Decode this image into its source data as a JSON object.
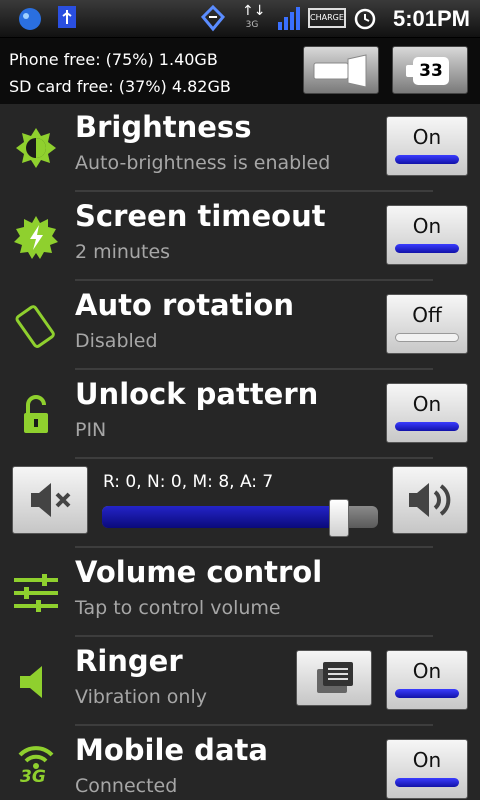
{
  "status_bar": {
    "time": "5:01PM",
    "network_type": "3G",
    "charge_label": "CHARGE",
    "icons": [
      "app-icon",
      "usb-icon",
      "sync-icon",
      "data-arrows-icon",
      "signal-icon",
      "charge-icon",
      "alarm-icon"
    ]
  },
  "storage": {
    "phone_free": "Phone free: (75%) 1.40GB",
    "sd_free": "SD card free: (37%) 4.82GB",
    "battery_level": "33"
  },
  "settings": [
    {
      "title": "Brightness",
      "subtitle": "Auto-brightness is enabled",
      "state": "On",
      "icon": "brightness-icon"
    },
    {
      "title": "Screen timeout",
      "subtitle": "2 minutes",
      "state": "On",
      "icon": "screen-timeout-icon"
    },
    {
      "title": "Auto rotation",
      "subtitle": "Disabled",
      "state": "Off",
      "icon": "rotation-icon"
    },
    {
      "title": "Unlock pattern",
      "subtitle": "PIN",
      "state": "On",
      "icon": "unlock-icon"
    }
  ],
  "volume": {
    "label": "R: 0, N: 0, M: 8, A: 7",
    "level": 0.86
  },
  "volume_control": {
    "title": "Volume control",
    "subtitle": "Tap to control volume"
  },
  "ringer": {
    "title": "Ringer",
    "subtitle": "Vibration only",
    "state": "On"
  },
  "mobile_data": {
    "title": "Mobile data",
    "subtitle": "Connected",
    "state": "On",
    "network_type": "3G"
  },
  "colors": {
    "accent_green": "#8fd02e",
    "toggle_on": "#2222d8"
  }
}
